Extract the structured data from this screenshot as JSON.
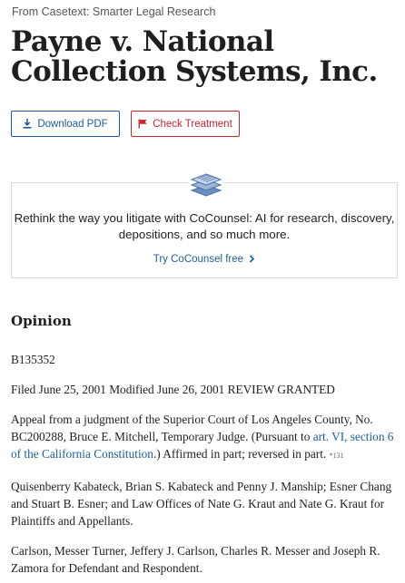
{
  "source_label": "From Casetext: Smarter Legal Research",
  "title": "Payne v. National Collection Systems, Inc.",
  "buttons": {
    "download_pdf": "Download PDF",
    "check_treatment": "Check Treatment"
  },
  "promo": {
    "icon": "stacked-layers-icon",
    "text": "Rethink the way you litigate with CoCounsel: AI for research, discovery, depositions, and so much more.",
    "link": "Try CoCounsel free"
  },
  "opinion": {
    "heading": "Opinion",
    "docket": "B135352",
    "filed": "Filed June 25, 2001 Modified June 26, 2001 REVIEW GRANTED",
    "appeal_pre": "Appeal from a judgment of the Superior Court of Los Angeles County, No. BC200288, Bruce E. Mitchell, Temporary Judge. (Pursuant to ",
    "appeal_link": "art. VI, section 6 of the California Constitution",
    "appeal_post": ".) Affirmed in part; reversed in part. ",
    "page_marker": "*131",
    "plaintiffs_counsel": "Quisenberry Kabateck, Brian S. Kabateck and Penny J. Manship; Esner Chang and Stuart B. Esner; and Law Offices of Nate G. Kraut and Nate G. Kraut for Plaintiffs and Appellants.",
    "defendant_counsel": "Carlson, Messer Turner, Jeffery J. Carlson, Charles R. Messer and Joseph R. Zamora for Defendant and Respondent."
  },
  "colors": {
    "link_blue": "#1c5d99",
    "treatment_red": "#c8262b"
  }
}
